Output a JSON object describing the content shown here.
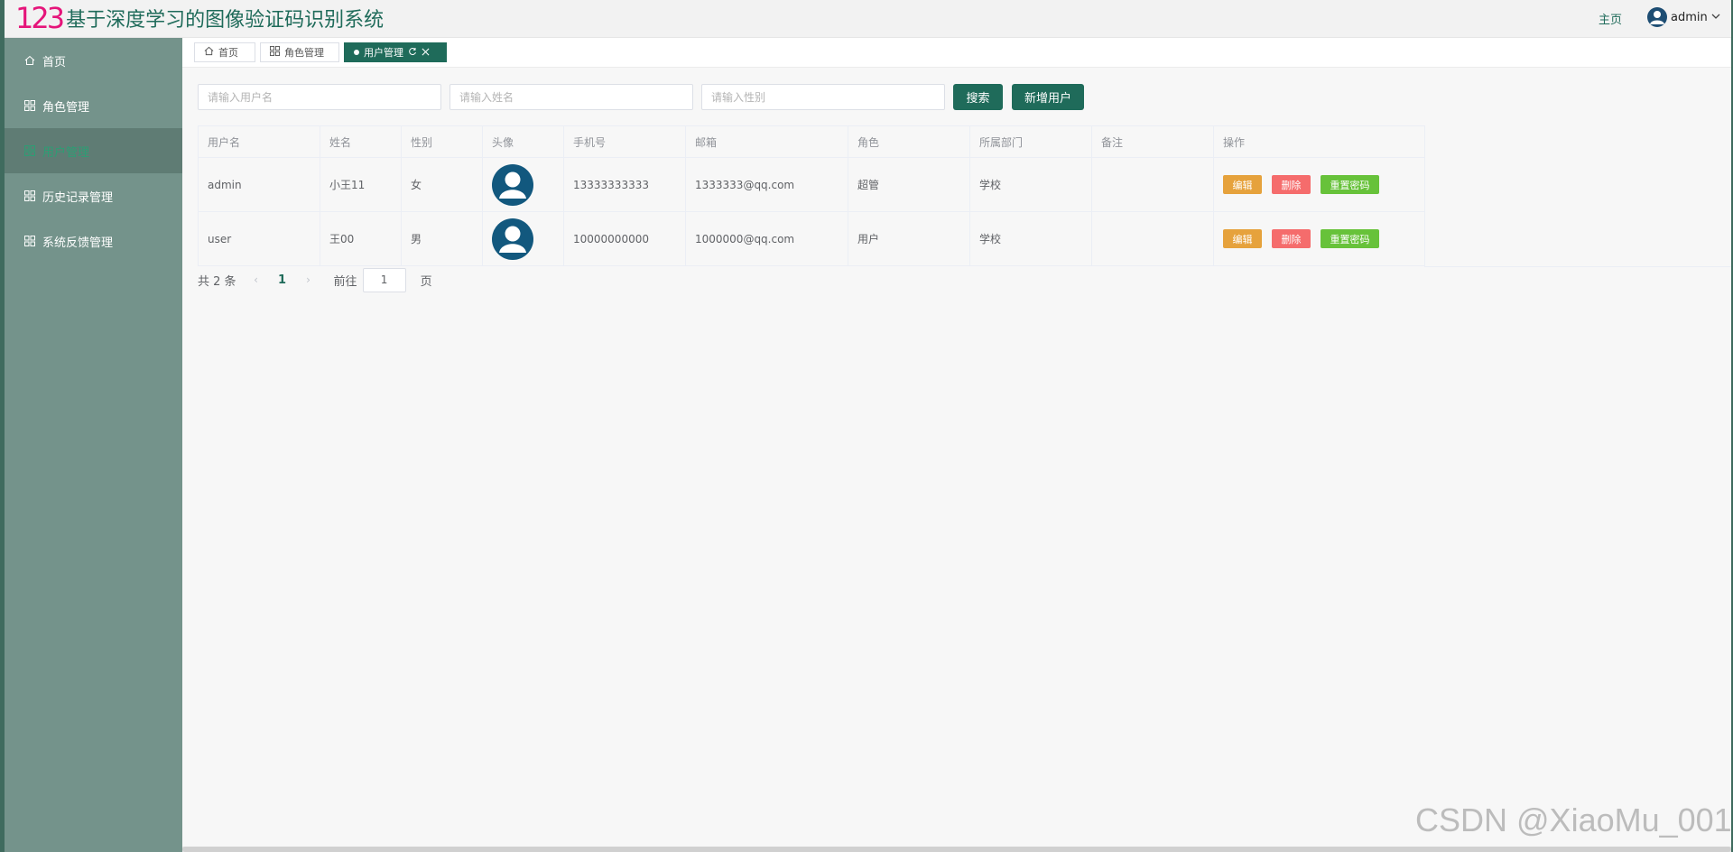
{
  "header": {
    "logo_text": "123",
    "title": "基于深度学习的图像验证码识别系统",
    "home_link": "主页",
    "user_name": "admin"
  },
  "sidebar": {
    "items": [
      {
        "label": "首页",
        "icon": "home-icon"
      },
      {
        "label": "角色管理",
        "icon": "grid-icon"
      },
      {
        "label": "用户管理",
        "icon": "grid-icon",
        "active": true
      },
      {
        "label": "历史记录管理",
        "icon": "grid-icon"
      },
      {
        "label": "系统反馈管理",
        "icon": "grid-icon"
      }
    ]
  },
  "tabs": [
    {
      "label": "首页"
    },
    {
      "label": "角色管理"
    },
    {
      "label": "用户管理",
      "active": true
    }
  ],
  "search": {
    "username_placeholder": "请输入用户名",
    "name_placeholder": "请输入姓名",
    "gender_placeholder": "请输入性别",
    "search_button": "搜索",
    "add_button": "新增用户"
  },
  "table": {
    "columns": [
      "用户名",
      "姓名",
      "性别",
      "头像",
      "手机号",
      "邮箱",
      "角色",
      "所属部门",
      "备注",
      "操作"
    ],
    "rows": [
      {
        "username": "admin",
        "name": "小王11",
        "gender": "女",
        "phone": "13333333333",
        "email": "1333333@qq.com",
        "role": "超管",
        "dept": "学校",
        "remark": ""
      },
      {
        "username": "user",
        "name": "王00",
        "gender": "男",
        "phone": "10000000000",
        "email": "1000000@qq.com",
        "role": "用户",
        "dept": "学校",
        "remark": ""
      }
    ],
    "actions": {
      "edit": "编辑",
      "delete": "删除",
      "reset": "重置密码"
    }
  },
  "pagination": {
    "total_text": "共 2 条",
    "current_page": "1",
    "goto_label": "前往",
    "goto_value": "1",
    "page_suffix": "页"
  },
  "watermark": "CSDN @XiaoMu_001",
  "colors": {
    "brand": "#1f6b5a",
    "sidebar": "#74938b",
    "edit": "#e6a23c",
    "delete": "#f56c6c",
    "reset": "#67c23a",
    "logo": "#e5157a"
  }
}
